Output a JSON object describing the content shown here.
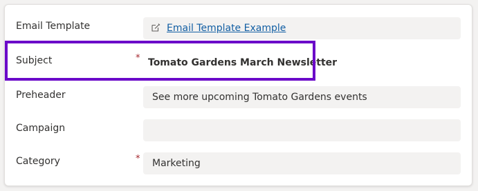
{
  "form": {
    "rows": [
      {
        "label": "Email Template",
        "required": false,
        "value": "Email Template Example",
        "type": "link"
      },
      {
        "label": "Subject",
        "required": true,
        "value": "Tomato Gardens March Newsletter",
        "type": "bold"
      },
      {
        "label": "Preheader",
        "required": false,
        "value": "See more upcoming Tomato Gardens events",
        "type": "text"
      },
      {
        "label": "Campaign",
        "required": false,
        "value": "",
        "type": "text"
      },
      {
        "label": "Category",
        "required": true,
        "value": "Marketing",
        "type": "text"
      }
    ],
    "required_mark": "*"
  },
  "colors": {
    "highlight": "#6b09c9",
    "link": "#115ea3",
    "required": "#a4262c"
  },
  "icons": {
    "email_template_link": "edit-icon"
  }
}
